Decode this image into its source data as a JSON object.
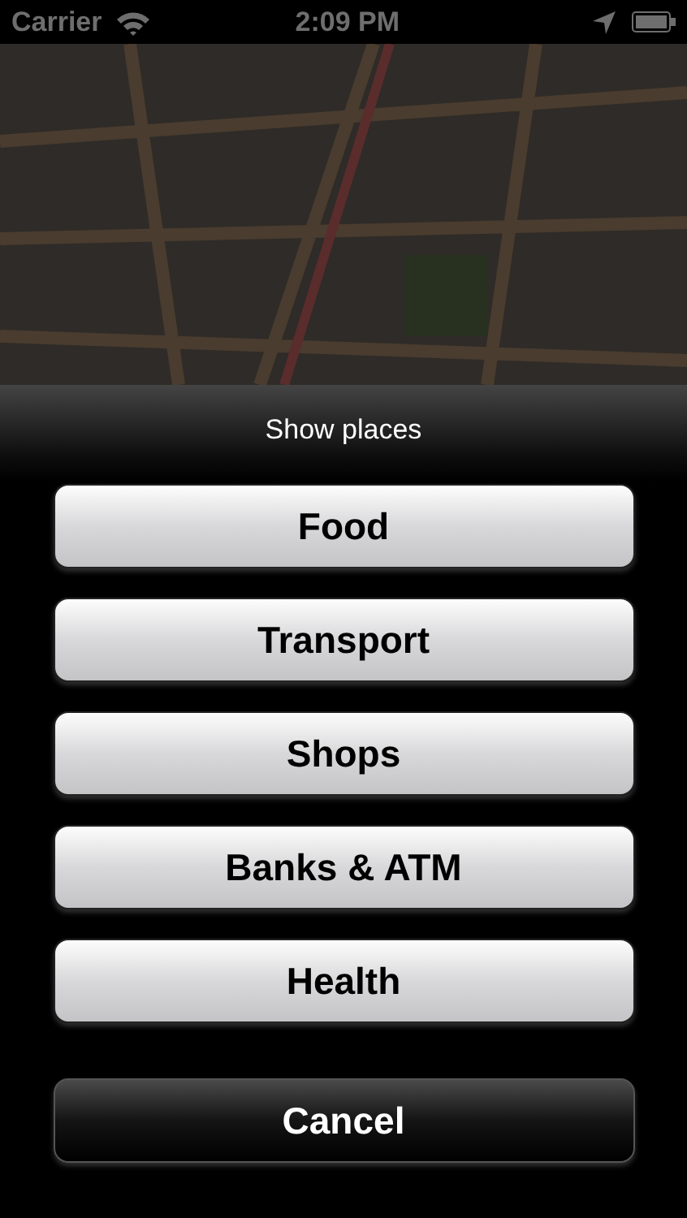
{
  "status_bar": {
    "carrier": "Carrier",
    "time": "2:09 PM"
  },
  "action_sheet": {
    "title": "Show places",
    "buttons": [
      {
        "label": "Food",
        "kind": "option"
      },
      {
        "label": "Transport",
        "kind": "option"
      },
      {
        "label": "Shops",
        "kind": "option"
      },
      {
        "label": "Banks & ATM",
        "kind": "option"
      },
      {
        "label": "Health",
        "kind": "option"
      },
      {
        "label": "Cancel",
        "kind": "cancel"
      }
    ]
  }
}
